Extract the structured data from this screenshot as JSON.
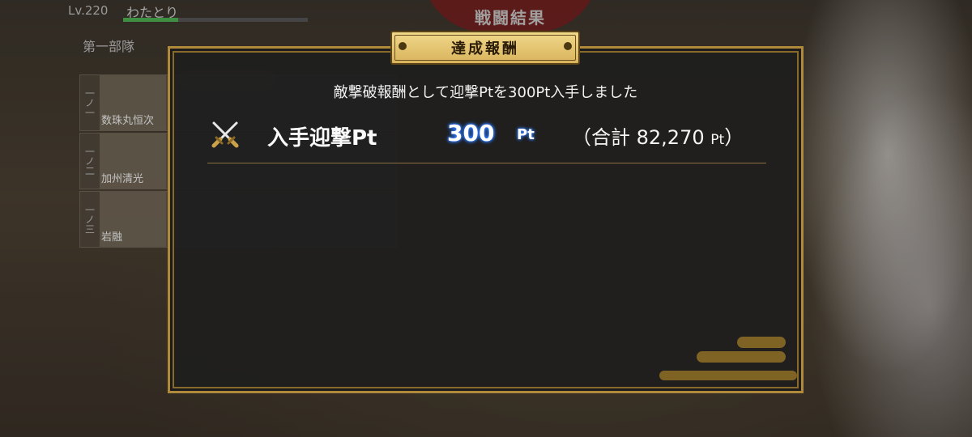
{
  "background": {
    "player_level": "Lv.220",
    "player_name": "わたとり",
    "banner_title": "戦闘結果",
    "squad_name": "第一部隊",
    "roster": [
      {
        "number": "一ノ一",
        "name": "数珠丸恒次"
      },
      {
        "number": "一ノ二",
        "name": "加州清光"
      },
      {
        "number": "一ノ三",
        "name": "岩融"
      }
    ]
  },
  "modal": {
    "title": "達成報酬",
    "message": "敵撃破報酬として迎撃Ptを300Pt入手しました",
    "reward": {
      "label": "入手迎撃Pt",
      "value": "300",
      "unit": "Pt",
      "total_prefix": "（合計 ",
      "total_value": "82,270",
      "total_unit": "Pt",
      "total_suffix": "）"
    }
  },
  "colors": {
    "frame_gold": "#b08a3a",
    "header_gold": "#e6c571",
    "value_glow": "#2f7cff",
    "panel_bg": "#1e1e1e"
  },
  "icons": {
    "reward": "crossed-swords-icon"
  }
}
